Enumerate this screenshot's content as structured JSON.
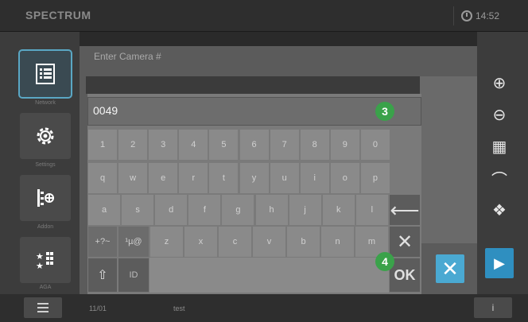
{
  "app": {
    "title": "SPECTRUM",
    "time": "14:52"
  },
  "sidebar": {
    "items": [
      {
        "label": "Network",
        "icon": "list-doc-icon"
      },
      {
        "label": "Settings",
        "icon": "gear-icon"
      },
      {
        "label": "Addon",
        "icon": "slider-target-icon"
      },
      {
        "label": "AGA",
        "icon": "stars-grid-icon"
      }
    ]
  },
  "dialog": {
    "title": "Enter Camera #"
  },
  "keyboard": {
    "input_value": "0049",
    "row_numbers": [
      "1",
      "2",
      "3",
      "4",
      "5",
      "6",
      "7",
      "8",
      "9",
      "0"
    ],
    "row_top": [
      "q",
      "w",
      "e",
      "r",
      "t",
      "y",
      "u",
      "i",
      "o",
      "p"
    ],
    "row_mid": [
      "a",
      "s",
      "d",
      "f",
      "g",
      "h",
      "j",
      "k",
      "l"
    ],
    "row_bottom": [
      "z",
      "x",
      "c",
      "v",
      "b",
      "n",
      "m"
    ],
    "sym1": "+?~",
    "sym2": "¹µ@",
    "shift": "⇧",
    "id_key": "ID",
    "backspace": "⟵",
    "delete": "✕",
    "ok": "OK"
  },
  "badges": {
    "b3": "3",
    "b4": "4"
  },
  "toolbar": {
    "zoom_in": "⊕",
    "zoom_out": "⊖",
    "grid": "▦",
    "curve": "⌒",
    "pattern": "❖",
    "play": "▶",
    "cancel": "✕"
  },
  "status": {
    "count": "11/01",
    "name": "test",
    "info": "i"
  }
}
